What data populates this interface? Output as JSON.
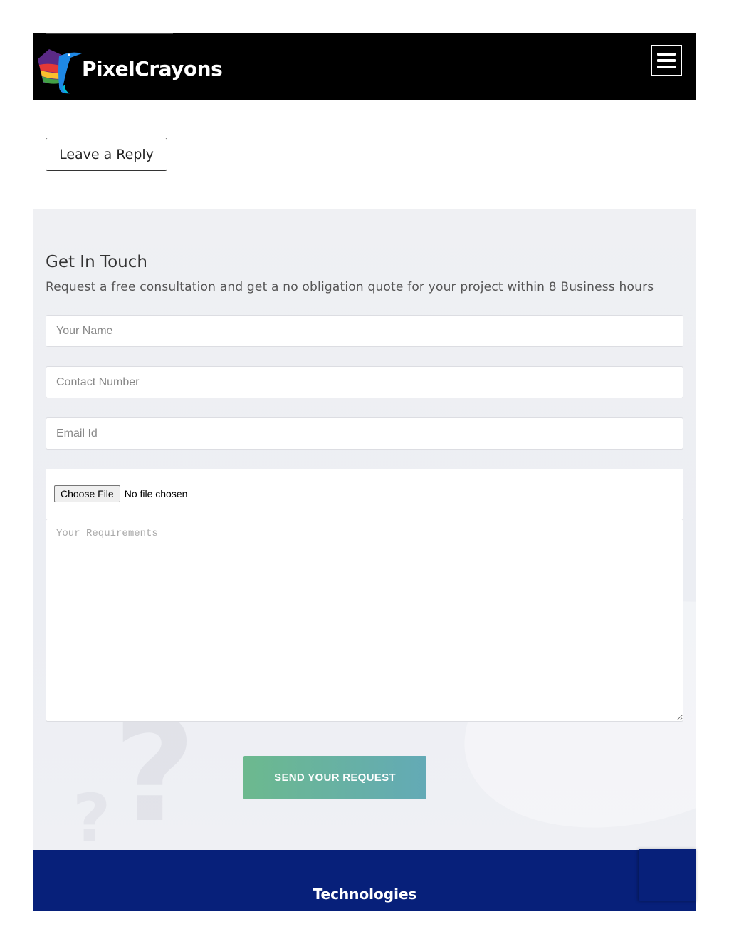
{
  "header": {
    "brand_name": "PixelCrayons",
    "logo_icon": "hummingbird-logo-icon",
    "menu_icon": "hamburger-menu-icon"
  },
  "reply": {
    "label": "Leave a Reply"
  },
  "contact": {
    "title": "Get In Touch",
    "subtitle": "Request a free consultation and get a no obligation quote for your project within 8 Business hours",
    "name_placeholder": "Your Name",
    "phone_placeholder": "Contact Number",
    "email_placeholder": "Email Id",
    "file_button": "Choose File",
    "file_status": "No file chosen",
    "requirements_placeholder": "Your Requirements",
    "submit_label": "SEND YOUR REQUEST"
  },
  "footer": {
    "title": "Technologies"
  },
  "colors": {
    "header_bg": "#000000",
    "section_bg": "#eef0f3",
    "submit_gradient_start": "#6cb98e",
    "submit_gradient_end": "#63aab6",
    "footer_bg": "#07207a"
  }
}
